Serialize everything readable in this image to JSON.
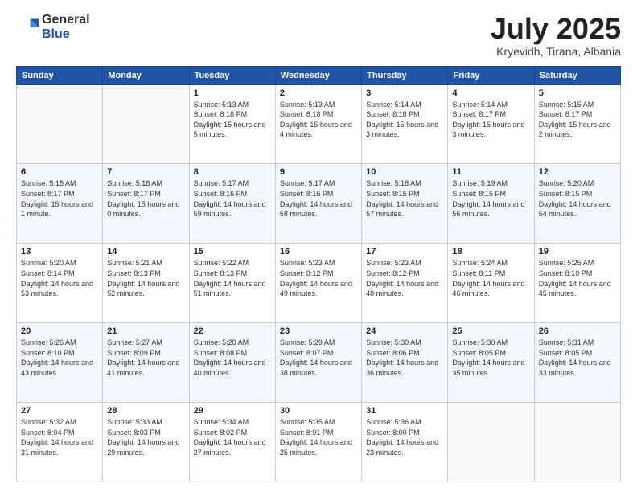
{
  "header": {
    "logo_general": "General",
    "logo_blue": "Blue",
    "title": "July 2025",
    "location": "Kryevidh, Tirana, Albania"
  },
  "weekdays": [
    "Sunday",
    "Monday",
    "Tuesday",
    "Wednesday",
    "Thursday",
    "Friday",
    "Saturday"
  ],
  "weeks": [
    [
      {
        "day": "",
        "empty": true
      },
      {
        "day": "",
        "empty": true
      },
      {
        "day": "1",
        "sunrise": "5:13 AM",
        "sunset": "8:18 PM",
        "daylight": "15 hours and 5 minutes."
      },
      {
        "day": "2",
        "sunrise": "5:13 AM",
        "sunset": "8:18 PM",
        "daylight": "15 hours and 4 minutes."
      },
      {
        "day": "3",
        "sunrise": "5:14 AM",
        "sunset": "8:18 PM",
        "daylight": "15 hours and 3 minutes."
      },
      {
        "day": "4",
        "sunrise": "5:14 AM",
        "sunset": "8:17 PM",
        "daylight": "15 hours and 3 minutes."
      },
      {
        "day": "5",
        "sunrise": "5:15 AM",
        "sunset": "8:17 PM",
        "daylight": "15 hours and 2 minutes."
      }
    ],
    [
      {
        "day": "6",
        "sunrise": "5:15 AM",
        "sunset": "8:17 PM",
        "daylight": "15 hours and 1 minute."
      },
      {
        "day": "7",
        "sunrise": "5:16 AM",
        "sunset": "8:17 PM",
        "daylight": "15 hours and 0 minutes."
      },
      {
        "day": "8",
        "sunrise": "5:17 AM",
        "sunset": "8:16 PM",
        "daylight": "14 hours and 59 minutes."
      },
      {
        "day": "9",
        "sunrise": "5:17 AM",
        "sunset": "8:16 PM",
        "daylight": "14 hours and 58 minutes."
      },
      {
        "day": "10",
        "sunrise": "5:18 AM",
        "sunset": "8:15 PM",
        "daylight": "14 hours and 57 minutes."
      },
      {
        "day": "11",
        "sunrise": "5:19 AM",
        "sunset": "8:15 PM",
        "daylight": "14 hours and 56 minutes."
      },
      {
        "day": "12",
        "sunrise": "5:20 AM",
        "sunset": "8:15 PM",
        "daylight": "14 hours and 54 minutes."
      }
    ],
    [
      {
        "day": "13",
        "sunrise": "5:20 AM",
        "sunset": "8:14 PM",
        "daylight": "14 hours and 53 minutes."
      },
      {
        "day": "14",
        "sunrise": "5:21 AM",
        "sunset": "8:13 PM",
        "daylight": "14 hours and 52 minutes."
      },
      {
        "day": "15",
        "sunrise": "5:22 AM",
        "sunset": "8:13 PM",
        "daylight": "14 hours and 51 minutes."
      },
      {
        "day": "16",
        "sunrise": "5:23 AM",
        "sunset": "8:12 PM",
        "daylight": "14 hours and 49 minutes."
      },
      {
        "day": "17",
        "sunrise": "5:23 AM",
        "sunset": "8:12 PM",
        "daylight": "14 hours and 48 minutes."
      },
      {
        "day": "18",
        "sunrise": "5:24 AM",
        "sunset": "8:11 PM",
        "daylight": "14 hours and 46 minutes."
      },
      {
        "day": "19",
        "sunrise": "5:25 AM",
        "sunset": "8:10 PM",
        "daylight": "14 hours and 45 minutes."
      }
    ],
    [
      {
        "day": "20",
        "sunrise": "5:26 AM",
        "sunset": "8:10 PM",
        "daylight": "14 hours and 43 minutes."
      },
      {
        "day": "21",
        "sunrise": "5:27 AM",
        "sunset": "8:09 PM",
        "daylight": "14 hours and 41 minutes."
      },
      {
        "day": "22",
        "sunrise": "5:28 AM",
        "sunset": "8:08 PM",
        "daylight": "14 hours and 40 minutes."
      },
      {
        "day": "23",
        "sunrise": "5:29 AM",
        "sunset": "8:07 PM",
        "daylight": "14 hours and 38 minutes."
      },
      {
        "day": "24",
        "sunrise": "5:30 AM",
        "sunset": "8:06 PM",
        "daylight": "14 hours and 36 minutes."
      },
      {
        "day": "25",
        "sunrise": "5:30 AM",
        "sunset": "8:05 PM",
        "daylight": "14 hours and 35 minutes."
      },
      {
        "day": "26",
        "sunrise": "5:31 AM",
        "sunset": "8:05 PM",
        "daylight": "14 hours and 33 minutes."
      }
    ],
    [
      {
        "day": "27",
        "sunrise": "5:32 AM",
        "sunset": "8:04 PM",
        "daylight": "14 hours and 31 minutes."
      },
      {
        "day": "28",
        "sunrise": "5:33 AM",
        "sunset": "8:03 PM",
        "daylight": "14 hours and 29 minutes."
      },
      {
        "day": "29",
        "sunrise": "5:34 AM",
        "sunset": "8:02 PM",
        "daylight": "14 hours and 27 minutes."
      },
      {
        "day": "30",
        "sunrise": "5:35 AM",
        "sunset": "8:01 PM",
        "daylight": "14 hours and 25 minutes."
      },
      {
        "day": "31",
        "sunrise": "5:36 AM",
        "sunset": "8:00 PM",
        "daylight": "14 hours and 23 minutes."
      },
      {
        "day": "",
        "empty": true
      },
      {
        "day": "",
        "empty": true
      }
    ]
  ],
  "labels": {
    "sunrise": "Sunrise:",
    "sunset": "Sunset:",
    "daylight": "Daylight:"
  }
}
